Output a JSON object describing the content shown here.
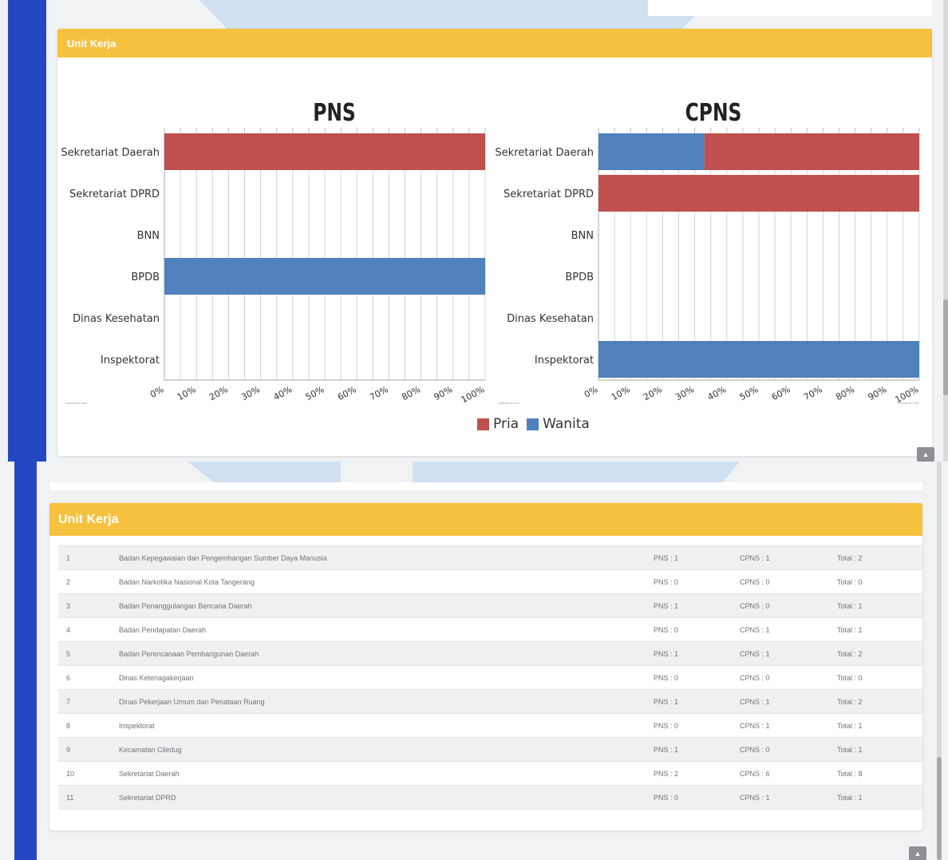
{
  "top_panel": {
    "card_title": "Unit Kerja",
    "charts": [
      {
        "title": "PNS",
        "credit": "CanvasJS.com",
        "ticks": [
          "0%",
          "10%",
          "20%",
          "30%",
          "40%",
          "50%",
          "60%",
          "70%",
          "80%",
          "90%",
          "100%"
        ]
      },
      {
        "title": "CPNS",
        "credit": "CanvasJS.com",
        "credit_right": "CanvasJS Trial",
        "ticks": [
          "0%",
          "10%",
          "20%",
          "30%",
          "40%",
          "50%",
          "60%",
          "70%",
          "80%",
          "90%",
          "100%"
        ]
      }
    ],
    "legend": [
      {
        "label": "Pria",
        "color": "#c0504e"
      },
      {
        "label": "Wanita",
        "color": "#4f81bc"
      }
    ],
    "scroll_top_label": "▲"
  },
  "chart_data": [
    {
      "type": "bar",
      "orientation": "horizontal",
      "stacked": "100%",
      "title": "PNS",
      "categories": [
        "Sekretariat Daerah",
        "Sekretariat DPRD",
        "BNN",
        "BPDB",
        "Dinas Kesehatan",
        "Inspektorat"
      ],
      "series": [
        {
          "name": "Wanita",
          "color": "#4f81bc",
          "values": [
            0,
            0,
            0,
            100,
            0,
            0
          ]
        },
        {
          "name": "Pria",
          "color": "#c0504e",
          "values": [
            100,
            0,
            0,
            0,
            0,
            0
          ]
        }
      ],
      "xlim": [
        0,
        100
      ],
      "x_unit": "%",
      "grid": true,
      "legend": "bottom"
    },
    {
      "type": "bar",
      "orientation": "horizontal",
      "stacked": "100%",
      "title": "CPNS",
      "categories": [
        "Sekretariat Daerah",
        "Sekretariat DPRD",
        "BNN",
        "BPDB",
        "Dinas Kesehatan",
        "Inspektorat"
      ],
      "series": [
        {
          "name": "Wanita",
          "color": "#4f81bc",
          "values": [
            33,
            0,
            0,
            0,
            0,
            100
          ]
        },
        {
          "name": "Pria",
          "color": "#c0504e",
          "values": [
            67,
            100,
            0,
            0,
            0,
            0
          ]
        }
      ],
      "xlim": [
        0,
        100
      ],
      "x_unit": "%",
      "grid": true,
      "legend": "bottom"
    }
  ],
  "bottom_panel": {
    "card_title": "Unit Kerja",
    "rows": [
      {
        "no": "1",
        "name": "Badan Kepegawaian dan Pengembangan Sumber Daya Manusia",
        "pns": "PNS : 1",
        "cpns": "CPNS : 1",
        "total": "Total : 2"
      },
      {
        "no": "2",
        "name": "Badan Narkotika Nasional Kota Tangerang",
        "pns": "PNS : 0",
        "cpns": "CPNS : 0",
        "total": "Total : 0"
      },
      {
        "no": "3",
        "name": "Badan Penanggulangan Bencana Daerah",
        "pns": "PNS : 1",
        "cpns": "CPNS : 0",
        "total": "Total : 1"
      },
      {
        "no": "4",
        "name": "Badan Pendapatan Daerah",
        "pns": "PNS : 0",
        "cpns": "CPNS : 1",
        "total": "Total : 1"
      },
      {
        "no": "5",
        "name": "Badan Perencanaan Pembangunan Daerah",
        "pns": "PNS : 1",
        "cpns": "CPNS : 1",
        "total": "Total : 2"
      },
      {
        "no": "6",
        "name": "Dinas Ketenagakerjaan",
        "pns": "PNS : 0",
        "cpns": "CPNS : 0",
        "total": "Total : 0"
      },
      {
        "no": "7",
        "name": "Dinas Pekerjaan Umum dan Penataan Ruang",
        "pns": "PNS : 1",
        "cpns": "CPNS : 1",
        "total": "Total : 2"
      },
      {
        "no": "8",
        "name": "Inspektorat",
        "pns": "PNS : 0",
        "cpns": "CPNS : 1",
        "total": "Total : 1"
      },
      {
        "no": "9",
        "name": "Kecamatan Ciledug",
        "pns": "PNS : 1",
        "cpns": "CPNS : 0",
        "total": "Total : 1"
      },
      {
        "no": "10",
        "name": "Sekretariat Daerah",
        "pns": "PNS : 2",
        "cpns": "CPNS : 6",
        "total": "Total : 8"
      },
      {
        "no": "11",
        "name": "Sekretariat DPRD",
        "pns": "PNS : 0",
        "cpns": "CPNS : 1",
        "total": "Total : 1"
      }
    ],
    "scroll_top_label": "▲"
  }
}
